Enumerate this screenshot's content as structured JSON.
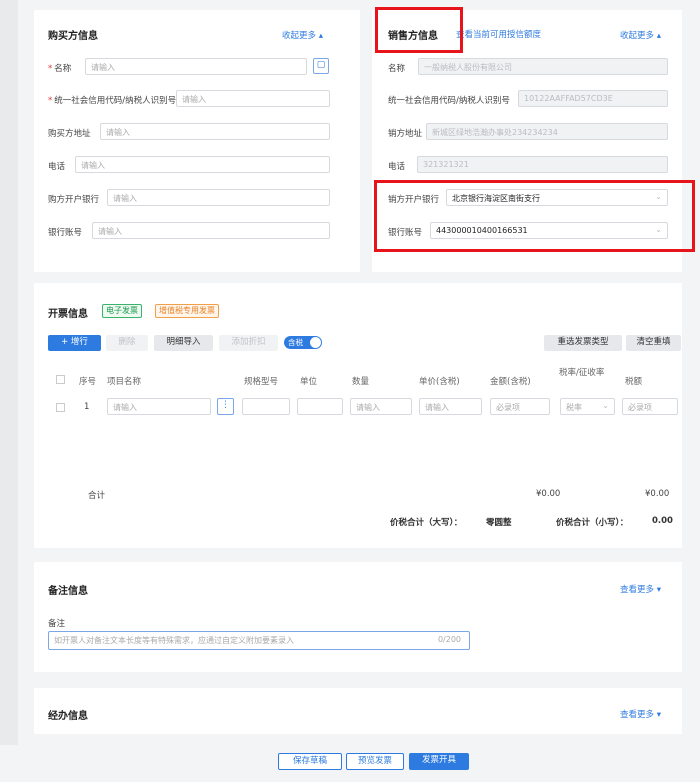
{
  "buyer": {
    "title": "购买方信息",
    "collapse": "收起更多 ▴",
    "fields": [
      {
        "label": "名称",
        "required": true,
        "placeholder": "请输入"
      },
      {
        "label": "统一社会信用代码/纳税人识别号",
        "required": true,
        "placeholder": "请输入"
      },
      {
        "label": "购买方地址",
        "required": false,
        "placeholder": "请输入"
      },
      {
        "label": "电话",
        "required": false,
        "placeholder": "请输入"
      },
      {
        "label": "购方开户银行",
        "required": false,
        "placeholder": "请输入"
      },
      {
        "label": "银行账号",
        "required": false,
        "placeholder": "请输入"
      }
    ]
  },
  "seller": {
    "title": "销售方信息",
    "link": "查看当前可用授信额度",
    "collapse": "收起更多 ▴",
    "fields": [
      {
        "label": "名称",
        "value": "一般纳税人股份有限公司"
      },
      {
        "label": "统一社会信用代码/纳税人识别号",
        "value": "10122AAFFAD57CD3E"
      },
      {
        "label": "销方地址",
        "value": "新城区绿地浩瀚办事处234234234"
      },
      {
        "label": "电话",
        "value": "321321321"
      },
      {
        "label": "销方开户银行",
        "value": "北京银行海淀区南街支行"
      },
      {
        "label": "银行账号",
        "value": "443000010400166531"
      }
    ]
  },
  "invoice": {
    "title": "开票信息",
    "tag_e": "电子发票",
    "tag_special": "增值税专用发票",
    "toolbar": {
      "add": "+ 增行",
      "delete": "删除",
      "import": "明细导入",
      "discount": "添加折扣",
      "tax_toggle": "含税",
      "reselect_type": "重选发票类型",
      "clear": "清空重填"
    },
    "columns": [
      "序号",
      "项目名称",
      "规格型号",
      "单位",
      "数量",
      "单价(含税)",
      "金额(含税)",
      "税率/征收率",
      "税额"
    ],
    "rows": [
      {
        "no": "1",
        "name": "请输入",
        "qty": "请输入",
        "price": "请输入",
        "amount": "必录项",
        "rate": "税率",
        "tax": "必录项"
      }
    ],
    "total_label": "合计",
    "total_amount": "¥0.00",
    "total_tax": "¥0.00",
    "sum_big_label": "价税合计（大写）：",
    "sum_big_value": "零圆整",
    "sum_small_label": "价税合计（小写）：",
    "sum_small_value": "0.00"
  },
  "remark": {
    "title": "备注信息",
    "more": "查看更多 ▾",
    "label": "备注",
    "placeholder": "如开票人对备注文本长度等有特殊需求，应通过自定义附加要素录入",
    "counter": "0/200"
  },
  "handler": {
    "title": "经办信息",
    "more": "查看更多 ▾"
  },
  "footer": {
    "save_draft": "保存草稿",
    "preview": "预览发票",
    "issue": "发票开具"
  }
}
